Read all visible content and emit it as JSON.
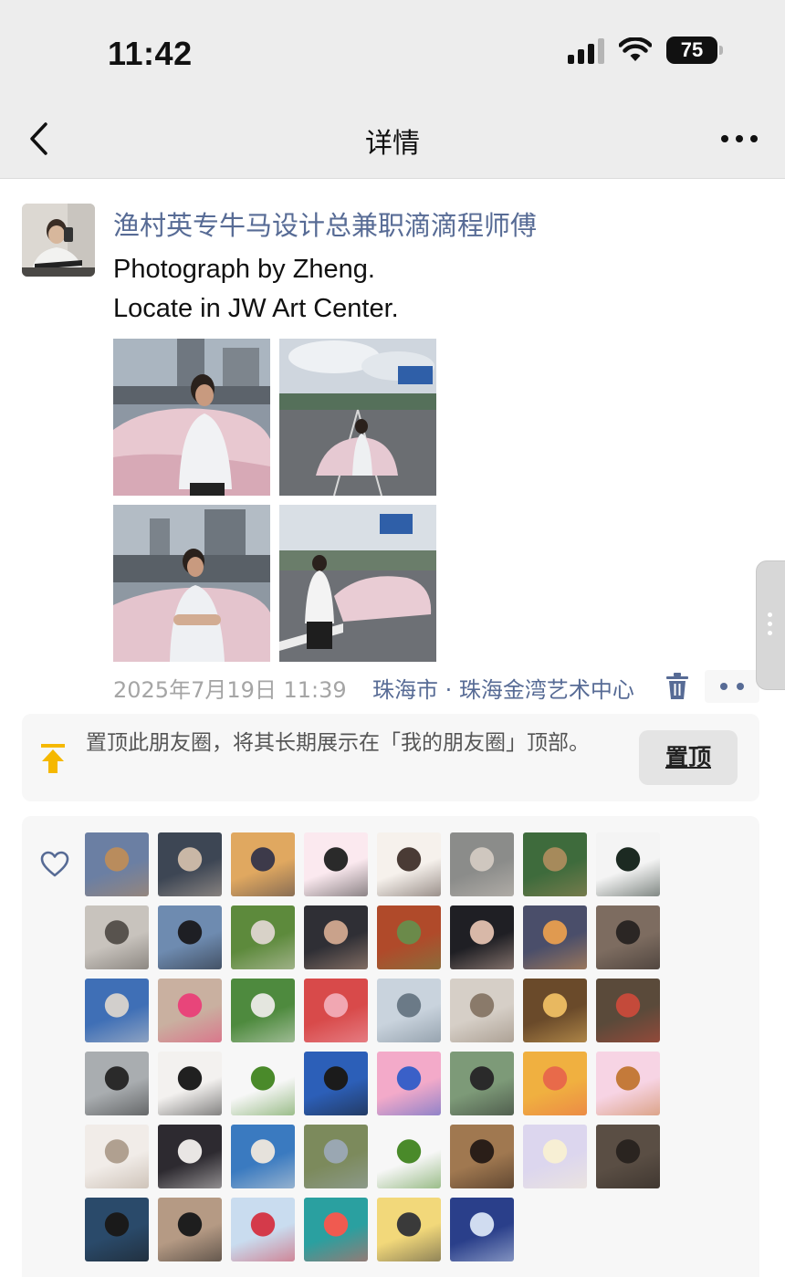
{
  "status_bar": {
    "time": "11:42",
    "battery": "75"
  },
  "nav": {
    "title": "详情"
  },
  "post": {
    "author": "渔村英专牛马设计总兼职滴滴程师傅",
    "text_line1": "Photograph by Zheng.",
    "text_line2": "Locate in JW Art Center.",
    "time": "2025年7月19日 11:39",
    "location": "珠海市 · 珠海金湾艺术中心"
  },
  "pin": {
    "text": "置顶此朋友圈，将其长期展示在「我的朋友圈」顶部。",
    "button_label": "置顶"
  },
  "likes": {
    "count": 46
  },
  "colors": {
    "link_blue": "#576b95",
    "pin_icon": "#f5b800",
    "meta_gray": "#a5a5a5"
  }
}
